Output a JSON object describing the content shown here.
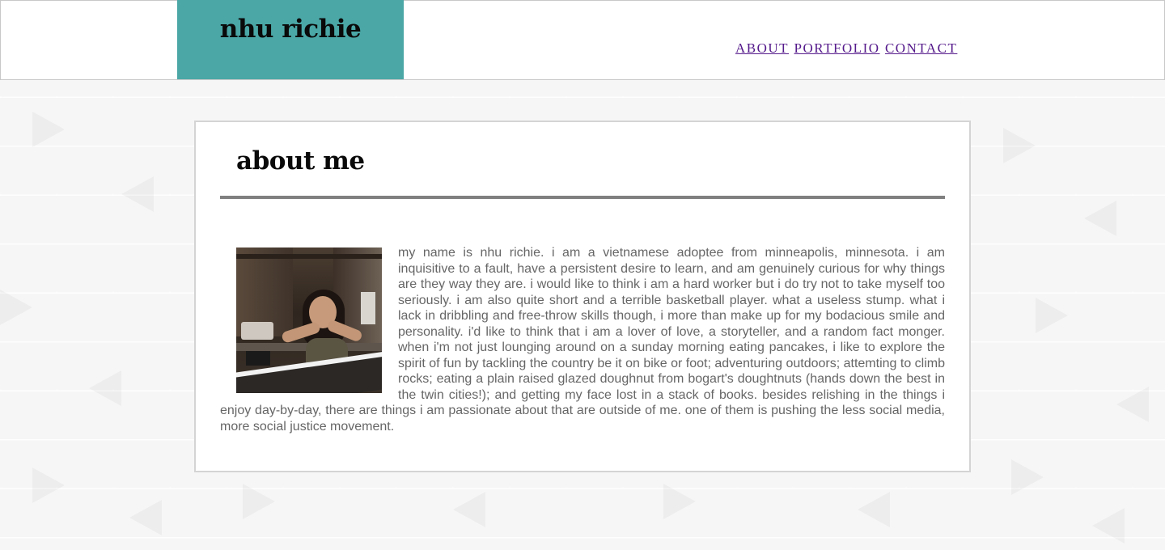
{
  "header": {
    "logo_text": "nhu richie",
    "logo_color": "#4aa7a6",
    "nav": [
      {
        "label": "ABOUT"
      },
      {
        "label": "PORTFOLIO"
      },
      {
        "label": "CONTACT"
      }
    ],
    "link_color": "#551a8b"
  },
  "about": {
    "title": "about me",
    "photo_icon": "profile-photo",
    "body": "my name is nhu richie. i am a vietnamese adoptee from minneapolis, minnesota. i am inquisitive to a fault, have a persistent desire to learn, and am genuinely curious for why things are they way they are. i would like to think i am a hard worker but i do try not to take myself too seriously. i am also quite short and a terrible basketball player. what a useless stump. what i lack in dribbling and free-throw skills though, i more than make up for my bodacious smile and personality. i'd like to think that i am a lover of love, a storyteller, and a random fact monger. when i'm not just lounging around on a sunday morning eating pancakes, i like to explore the spirit of fun by tackling the country be it on bike or foot; adventuring outdoors; attemting to climb rocks; eating a plain raised glazed doughnut from bogart's doughtnuts (hands down the best in the twin cities!); and getting my face lost in a stack of books. besides relishing in the things i enjoy day-by-day, there are things i am passionate about that are outside of me. one of them is pushing the less social media, more social justice movement."
  }
}
